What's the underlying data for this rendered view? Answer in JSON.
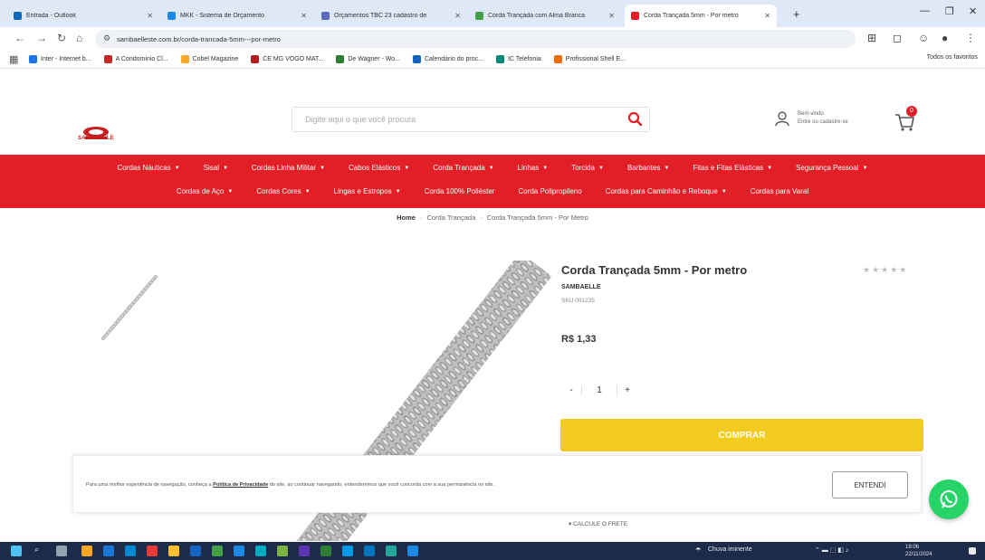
{
  "browser": {
    "tabs": [
      {
        "title": "Entrada - Outlook",
        "color": "#0f6cbd",
        "active": false
      },
      {
        "title": "MKK - Sistema de Orçamento",
        "color": "#1e88e5",
        "active": false
      },
      {
        "title": "Orçamentos TBC 23 cadastro de",
        "color": "#5c6bc0",
        "active": false
      },
      {
        "title": "Corda Trançada com Alma Branca",
        "color": "#43a047",
        "active": false
      },
      {
        "title": "Corda Trançada 5mm - Por metro",
        "color": "#e21f26",
        "active": true
      }
    ],
    "url": "sambaelleste.com.br/corda-trancada-5mm---por-metro",
    "bookmarks": [
      {
        "label": "Inter - Internet b...",
        "color": "#1a73e8"
      },
      {
        "label": "A Condominio Cl...",
        "color": "#c62828"
      },
      {
        "label": "Cobel Magazine",
        "color": "#f9a825"
      },
      {
        "label": "CE MG VOGO MAT...",
        "color": "#b71c1c"
      },
      {
        "label": "De Wagner - Wo...",
        "color": "#2e7d32"
      },
      {
        "label": "Calendário do proc...",
        "color": "#1565c0"
      },
      {
        "label": "IC Telefonia",
        "color": "#00897b"
      },
      {
        "label": "Profissional Shell E...",
        "color": "#ef6c00"
      }
    ],
    "all_bookmarks": "Todos os favoritos"
  },
  "header": {
    "logo_text": "SAMBAELLE",
    "search_placeholder": "Digite aqui o que você procura",
    "account_line1": "Bem-vindo",
    "account_line2": "Entre ou cadastre-se",
    "cart_count": "0"
  },
  "menu": {
    "row1": [
      {
        "label": "Cordas Náuticas",
        "caret": true
      },
      {
        "label": "Sisal",
        "caret": true
      },
      {
        "label": "Cordas Linha Militar",
        "caret": true
      },
      {
        "label": "Cabos Elásticos",
        "caret": true
      },
      {
        "label": "Corda Trançada",
        "caret": true
      },
      {
        "label": "Linhas",
        "caret": true
      },
      {
        "label": "Torcida",
        "caret": true
      },
      {
        "label": "Barbantes",
        "caret": true
      },
      {
        "label": "Fitas e Fitas Elásticas",
        "caret": true
      },
      {
        "label": "Segurança Pessoal",
        "caret": true
      }
    ],
    "row2": [
      {
        "label": "Cordas de Aço",
        "caret": true
      },
      {
        "label": "Cordas Cores",
        "caret": true
      },
      {
        "label": "Lingas e Estropos",
        "caret": true
      },
      {
        "label": "Corda 100% Poliéster",
        "caret": false
      },
      {
        "label": "Corda Polipropileno",
        "caret": false
      },
      {
        "label": "Cordas para Caminhão e Reboque",
        "caret": true
      },
      {
        "label": "Cordas para Varal",
        "caret": false
      }
    ]
  },
  "breadcrumb": {
    "home": "Home",
    "category": "Corda Trançada",
    "current": "Corda Trançada 5mm - Por Metro"
  },
  "product": {
    "title": "Corda Trançada 5mm - Por metro",
    "stars": "★★★★★",
    "brand": "SAMBAELLE",
    "sku": "SKU 001235",
    "price": "R$ 1,33",
    "qty_minus": "-",
    "qty_value": "1",
    "qty_plus": "+",
    "buy_label": "COMPRAR",
    "calc_label": "CALCULE O FRETE"
  },
  "cookie": {
    "text_before": "Para uma melhor experiência de navegação, conheça a ",
    "link": "Política de Privacidade",
    "text_after": " do site, ao continuar navegando, entenderemos que você concorda com a sua permanência no site.",
    "button": "ENTENDI"
  },
  "taskbar": {
    "weather": "Chuva iminente",
    "time": "19:06",
    "date": "22/11/2024"
  },
  "colors": {
    "brand_red": "#e21f26",
    "buy_yellow": "#f2cb1e",
    "whatsapp_green": "#25d366",
    "taskbar": "#1c2b4a"
  }
}
